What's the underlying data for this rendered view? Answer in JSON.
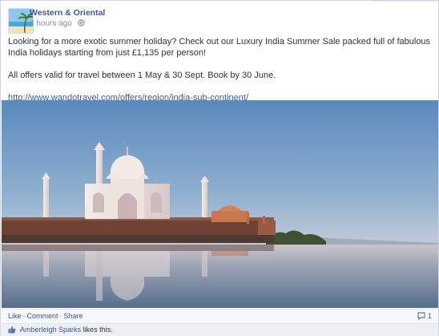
{
  "post": {
    "author": "Western & Oriental",
    "time": "4 hours ago",
    "text_line1": "Looking for a more exotic summer holiday? Check out our Luxury India Summer Sale packed full of fabulous India holidays starting from just £1,135 per person!",
    "text_line2": "All offers valid for travel between 1 May & 30 Sept. Book by 30 June.",
    "link": "http://www.wandotravel.com/offers/region/india-sub-continent/"
  },
  "actions": {
    "like": "Like",
    "comment": "Comment",
    "share": "Share",
    "separator": "·",
    "comment_count": "1"
  },
  "likes": {
    "name": "Amberleigh Sparks",
    "suffix": " likes this."
  },
  "icons": {
    "audience": "public-globe-icon",
    "comment_count": "comment-bubble-icon",
    "like": "thumbs-up-icon"
  },
  "colors": {
    "link_blue": "#3b5998",
    "sky_top": "#5d8cbf",
    "sky_bottom": "#e9dfd9"
  }
}
